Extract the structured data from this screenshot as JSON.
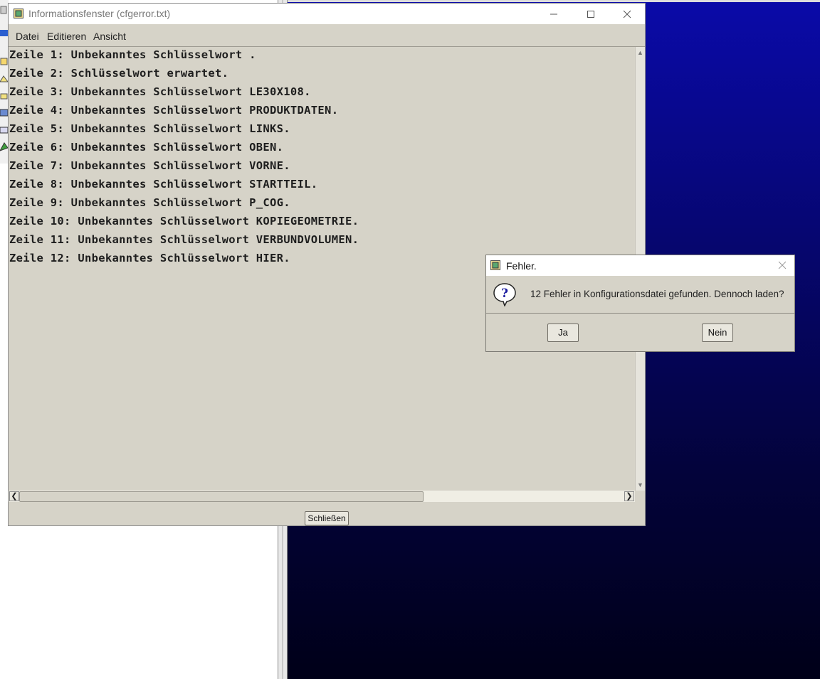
{
  "background": {
    "viewport_gradient": [
      "#0a0aa8",
      "#000018"
    ]
  },
  "info_window": {
    "title": "Informationsfenster (cfgerror.txt)",
    "window_buttons": [
      "minimize-icon",
      "maximize-icon",
      "close-icon"
    ],
    "menu": [
      "Datei",
      "Editieren",
      "Ansicht"
    ],
    "lines": [
      "Zeile 1: Unbekanntes Schlüsselwort .",
      "Zeile 2: Schlüsselwort erwartet.",
      "Zeile 3: Unbekanntes Schlüsselwort LE30X108.",
      "Zeile 4: Unbekanntes Schlüsselwort PRODUKTDATEN.",
      "Zeile 5: Unbekanntes Schlüsselwort LINKS.",
      "Zeile 6: Unbekanntes Schlüsselwort OBEN.",
      "Zeile 7: Unbekanntes Schlüsselwort VORNE.",
      "Zeile 8: Unbekanntes Schlüsselwort STARTTEIL.",
      "Zeile 9: Unbekanntes Schlüsselwort P_COG.",
      "Zeile 10: Unbekanntes Schlüsselwort KOPIEGEOMETRIE.",
      "Zeile 11: Unbekanntes Schlüsselwort VERBUNDVOLUMEN.",
      "Zeile 12: Unbekanntes Schlüsselwort HIER."
    ],
    "close_button": "Schließen"
  },
  "dialog": {
    "title": "Fehler.",
    "message": "12 Fehler in Konfigurationsdatei gefunden. Dennoch laden?",
    "icon": "question-icon",
    "yes_button": "Ja",
    "no_button": "Nein"
  }
}
